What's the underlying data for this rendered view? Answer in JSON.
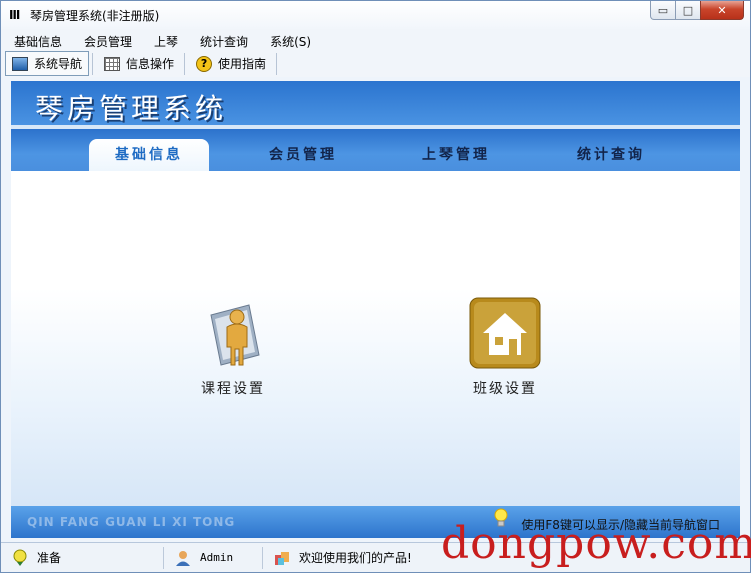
{
  "window": {
    "title": "琴房管理系统(非注册版)",
    "app_icon_glyph": "Ⅲ",
    "controls": {
      "minimize": "▭",
      "maximize": "□",
      "close": "✕"
    }
  },
  "menubar": {
    "items": [
      "基础信息",
      "会员管理",
      "上琴",
      "统计查询",
      "系统(S)"
    ]
  },
  "toolbar": {
    "buttons": [
      {
        "label": "系统导航",
        "icon": "monitor-icon"
      },
      {
        "label": "信息操作",
        "icon": "grid-icon"
      },
      {
        "label": "使用指南",
        "icon": "help-icon",
        "glyph": "?"
      }
    ]
  },
  "banner": {
    "title": "琴房管理系统"
  },
  "tabs": [
    {
      "label": "基础信息",
      "active": true
    },
    {
      "label": "会员管理",
      "active": false
    },
    {
      "label": "上琴管理",
      "active": false
    },
    {
      "label": "统计查询",
      "active": false
    }
  ],
  "launchers": [
    {
      "label": "课程设置",
      "icon": "person-icon"
    },
    {
      "label": "班级设置",
      "icon": "house-icon"
    }
  ],
  "footer": {
    "pinyin": "QIN FANG GUAN LI XI TONG",
    "hint": "使用F8键可以显示/隐藏当前导航窗口"
  },
  "statusbar": {
    "ready": "准备",
    "user": "Admin",
    "welcome": "欢迎使用我们的产品!"
  },
  "watermark": "dongpow.com",
  "colors": {
    "banner_blue": "#2b74cf",
    "tab_active_text": "#1e6bc3",
    "watermark_red": "#c81e1e"
  }
}
